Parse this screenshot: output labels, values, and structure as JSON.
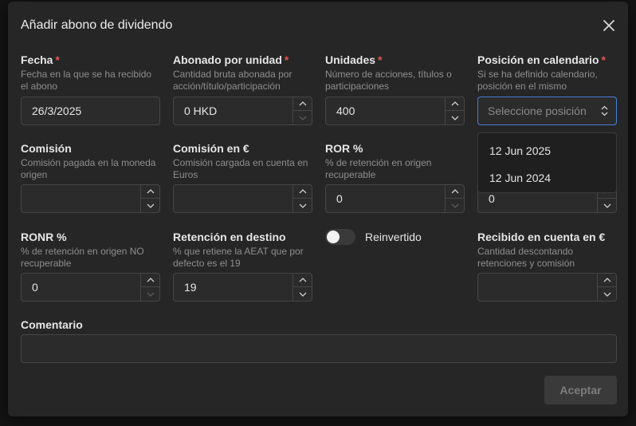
{
  "dialog": {
    "title": "Añadir abono de dividendo",
    "accept_label": "Aceptar"
  },
  "fields": {
    "fecha": {
      "label": "Fecha",
      "required": "*",
      "desc": "Fecha en la que se ha recibido el abono",
      "value": "26/3/2025"
    },
    "abonado": {
      "label": "Abonado por unidad",
      "required": "*",
      "desc": "Cantidad bruta abonada por acción/título/participación",
      "value": "0 HKD"
    },
    "unidades": {
      "label": "Unidades",
      "required": "*",
      "desc": "Número de acciones, títulos o participaciones",
      "value": "400"
    },
    "posicion": {
      "label": "Posición en calendario",
      "required": "*",
      "desc": "Si se ha definido calendario, posición en el mismo",
      "placeholder": "Seleccione posición",
      "options": [
        "12 Jun 2025",
        "12 Jun 2024"
      ]
    },
    "comision": {
      "label": "Comisión",
      "desc": "Comisión pagada en la moneda origen",
      "value": ""
    },
    "comision_eur": {
      "label": "Comisión en €",
      "desc": "Comisión cargada en cuenta en Euros",
      "value": ""
    },
    "ror": {
      "label": "ROR %",
      "desc": "% de retención en origen recuperable",
      "value": "0"
    },
    "col4_row2": {
      "value": "0"
    },
    "ronr": {
      "label": "RONR %",
      "desc": "% de retención en origen NO recuperable",
      "value": "0"
    },
    "retencion_destino": {
      "label": "Retención en destino",
      "desc": "% que retiene la AEAT que por defecto es el 19",
      "value": "19"
    },
    "reinvertido": {
      "label": "Reinvertido",
      "checked": false
    },
    "recibido": {
      "label": "Recibido en cuenta en €",
      "desc": "Cantidad descontando retenciones y comisión",
      "value": ""
    },
    "comentario": {
      "label": "Comentario",
      "value": ""
    }
  }
}
